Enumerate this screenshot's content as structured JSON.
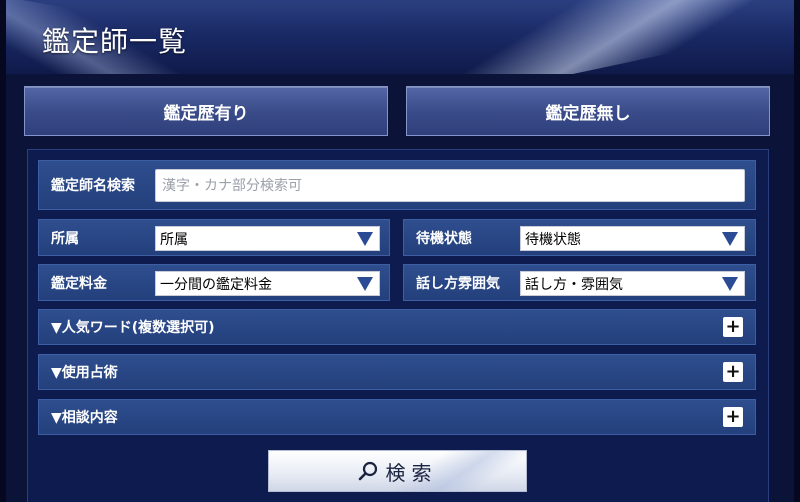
{
  "header": {
    "title": "鑑定師一覧"
  },
  "tabs": [
    {
      "label": "鑑定歴有り"
    },
    {
      "label": "鑑定歴無し"
    }
  ],
  "search_form": {
    "name_search": {
      "label": "鑑定師名検索",
      "placeholder": "漢字・カナ部分検索可",
      "value": ""
    },
    "affiliation": {
      "label": "所属",
      "selected": "所属"
    },
    "status": {
      "label": "待機状態",
      "selected": "待機状態"
    },
    "fee": {
      "label": "鑑定料金",
      "selected": "一分間の鑑定料金"
    },
    "atmosphere": {
      "label": "話し方雰囲気",
      "selected": "話し方・雰囲気"
    }
  },
  "accordions": [
    {
      "label": "▼人気ワード(複数選択可)",
      "toggle": "+"
    },
    {
      "label": "▼使用占術",
      "toggle": "+"
    },
    {
      "label": "▼相談内容",
      "toggle": "+"
    }
  ],
  "search_button": {
    "label": "検索",
    "icon": "search-icon"
  },
  "colors": {
    "background": "#0b1438",
    "row": "#23407c",
    "accent_arrow": "#2b4c94"
  }
}
